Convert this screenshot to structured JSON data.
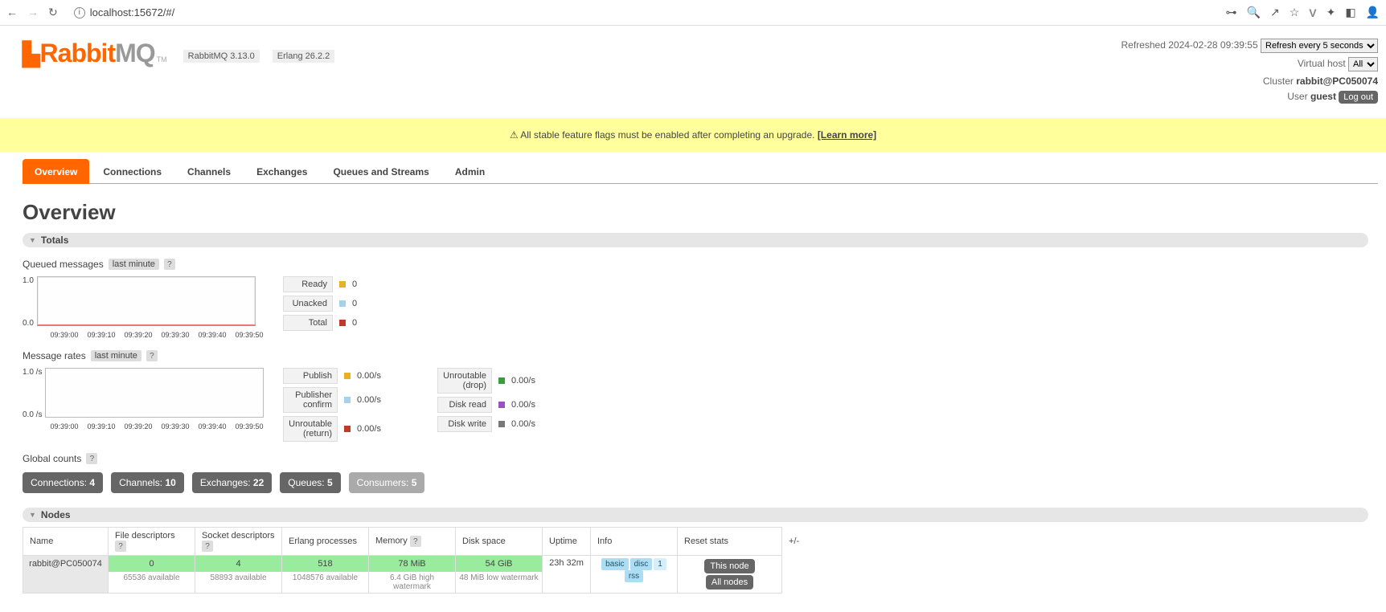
{
  "browser": {
    "url": "localhost:15672/#/"
  },
  "header": {
    "logo_text_rabbit": "Rabbit",
    "logo_text_mq": "MQ",
    "tm": "TM",
    "ver_rabbit": "RabbitMQ 3.13.0",
    "ver_erlang": "Erlang 26.2.2",
    "refreshed": "Refreshed 2024-02-28 09:39:55",
    "refresh_opt": "Refresh every 5 seconds",
    "vhost_label": "Virtual host",
    "vhost_val": "All",
    "cluster_label": "Cluster",
    "cluster_val": "rabbit@PC050074",
    "user_label": "User",
    "user_val": "guest",
    "logout": "Log out"
  },
  "banner": {
    "warn_icon": "⚠",
    "msg": " All stable feature flags must be enabled after completing an upgrade. ",
    "link": "[Learn more]"
  },
  "tabs": {
    "overview": "Overview",
    "connections": "Connections",
    "channels": "Channels",
    "exchanges": "Exchanges",
    "queues": "Queues and Streams",
    "admin": "Admin"
  },
  "page_title": "Overview",
  "sections": {
    "totals": "Totals",
    "nodes": "Nodes"
  },
  "queued": {
    "label": "Queued messages",
    "period": "last minute",
    "y_top": "1.0",
    "y_bot": "0.0",
    "x": [
      "09:39:00",
      "09:39:10",
      "09:39:20",
      "09:39:30",
      "09:39:40",
      "09:39:50"
    ],
    "legend": {
      "ready": {
        "label": "Ready",
        "val": "0",
        "color": "#e8b025"
      },
      "unacked": {
        "label": "Unacked",
        "val": "0",
        "color": "#a5d1ec"
      },
      "total": {
        "label": "Total",
        "val": "0",
        "color": "#c2392c"
      }
    }
  },
  "rates": {
    "label": "Message rates",
    "period": "last minute",
    "y_top": "1.0 /s",
    "y_bot": "0.0 /s",
    "x": [
      "09:39:00",
      "09:39:10",
      "09:39:20",
      "09:39:30",
      "09:39:40",
      "09:39:50"
    ],
    "legend1": {
      "publish": {
        "label": "Publish",
        "val": "0.00/s",
        "color": "#e8b025"
      },
      "pconfirm": {
        "label": "Publisher confirm",
        "val": "0.00/s",
        "color": "#a5d1ec"
      },
      "ureturn": {
        "label": "Unroutable (return)",
        "val": "0.00/s",
        "color": "#c2392c"
      }
    },
    "legend2": {
      "udrop": {
        "label": "Unroutable (drop)",
        "val": "0.00/s",
        "color": "#3a9c3a"
      },
      "dread": {
        "label": "Disk read",
        "val": "0.00/s",
        "color": "#9a4fc2"
      },
      "dwrite": {
        "label": "Disk write",
        "val": "0.00/s",
        "color": "#777"
      }
    }
  },
  "global_counts": {
    "label": "Global counts",
    "connections": {
      "label": "Connections:",
      "val": "4"
    },
    "channels": {
      "label": "Channels:",
      "val": "10"
    },
    "exchanges": {
      "label": "Exchanges:",
      "val": "22"
    },
    "queues": {
      "label": "Queues:",
      "val": "5"
    },
    "consumers": {
      "label": "Consumers:",
      "val": "5"
    }
  },
  "nodes_table": {
    "headers": {
      "name": "Name",
      "fd": "File descriptors",
      "sd": "Socket descriptors",
      "ep": "Erlang processes",
      "mem": "Memory",
      "disk": "Disk space",
      "uptime": "Uptime",
      "info": "Info",
      "reset": "Reset stats",
      "pm": "+/-"
    },
    "row": {
      "name": "rabbit@PC050074",
      "fd": "0",
      "fd_sub": "65536 available",
      "sd": "4",
      "sd_sub": "58893 available",
      "ep": "518",
      "ep_sub": "1048576 available",
      "mem": "78 MiB",
      "mem_sub": "6.4 GiB high watermark",
      "disk": "54 GiB",
      "disk_sub": "48 MiB low watermark",
      "uptime": "23h 32m",
      "info": {
        "basic": "basic",
        "disc": "disc",
        "one": "1",
        "rss": "rss"
      },
      "reset": {
        "this": "This node",
        "all": "All nodes"
      }
    }
  },
  "chart_data": [
    {
      "type": "line",
      "title": "Queued messages",
      "x": [
        "09:39:00",
        "09:39:10",
        "09:39:20",
        "09:39:30",
        "09:39:40",
        "09:39:50"
      ],
      "ylim": [
        0,
        1.0
      ],
      "series": [
        {
          "name": "Ready",
          "values": [
            0,
            0,
            0,
            0,
            0,
            0
          ]
        },
        {
          "name": "Unacked",
          "values": [
            0,
            0,
            0,
            0,
            0,
            0
          ]
        },
        {
          "name": "Total",
          "values": [
            0,
            0,
            0,
            0,
            0,
            0
          ]
        }
      ]
    },
    {
      "type": "line",
      "title": "Message rates",
      "x": [
        "09:39:00",
        "09:39:10",
        "09:39:20",
        "09:39:30",
        "09:39:40",
        "09:39:50"
      ],
      "ylim": [
        0,
        1.0
      ],
      "ylabel": "/s",
      "series": [
        {
          "name": "Publish",
          "values": [
            0,
            0,
            0,
            0,
            0,
            0
          ]
        },
        {
          "name": "Publisher confirm",
          "values": [
            0,
            0,
            0,
            0,
            0,
            0
          ]
        },
        {
          "name": "Unroutable (return)",
          "values": [
            0,
            0,
            0,
            0,
            0,
            0
          ]
        },
        {
          "name": "Unroutable (drop)",
          "values": [
            0,
            0,
            0,
            0,
            0,
            0
          ]
        },
        {
          "name": "Disk read",
          "values": [
            0,
            0,
            0,
            0,
            0,
            0
          ]
        },
        {
          "name": "Disk write",
          "values": [
            0,
            0,
            0,
            0,
            0,
            0
          ]
        }
      ]
    }
  ]
}
